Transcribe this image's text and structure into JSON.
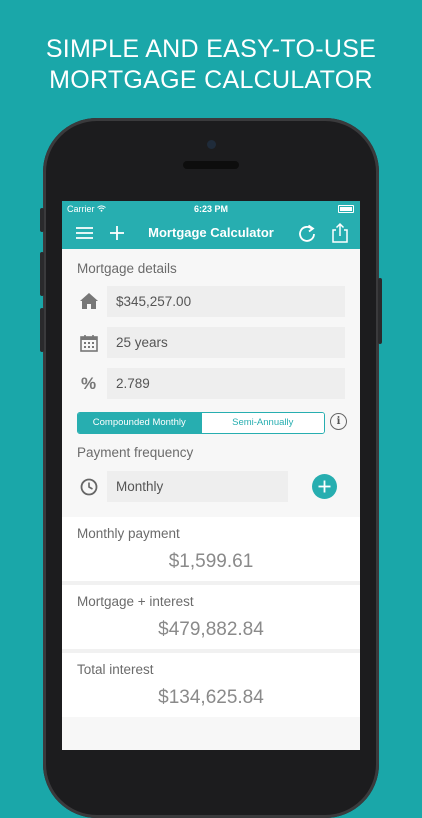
{
  "promo": {
    "line1": "SIMPLE AND EASY-TO-USE",
    "line2": "MORTGAGE CALCULATOR"
  },
  "status_bar": {
    "carrier": "Carrier",
    "time": "6:23 PM"
  },
  "nav_bar": {
    "title": "Mortgage Calculator",
    "left_icons": [
      "menu-icon",
      "plus-icon"
    ],
    "right_icons": [
      "refresh-icon",
      "share-icon"
    ]
  },
  "mortgage_details": {
    "section_label": "Mortgage details",
    "loan_amount": {
      "icon": "home-icon",
      "value": "$345,257.00"
    },
    "term": {
      "icon": "calendar-icon",
      "value": "25 years"
    },
    "rate": {
      "icon": "percent-icon",
      "symbol": "%",
      "value": "2.789"
    }
  },
  "compounding": {
    "options": [
      "Compounded Monthly",
      "Semi-Annually"
    ],
    "selected": "Compounded Monthly",
    "info_symbol": "i"
  },
  "payment_frequency": {
    "section_label": "Payment frequency",
    "icon": "clock-icon",
    "value": "Monthly",
    "add_icon": "plus-circle-icon"
  },
  "results": [
    {
      "label": "Monthly payment",
      "value": "$1,599.61"
    },
    {
      "label": "Mortgage + interest",
      "value": "$479,882.84"
    },
    {
      "label": "Total interest",
      "value": "$134,625.84"
    }
  ],
  "colors": {
    "background": "#1aa7a9",
    "accent": "#27aeb0",
    "phone_body": "#1c1c1e"
  }
}
